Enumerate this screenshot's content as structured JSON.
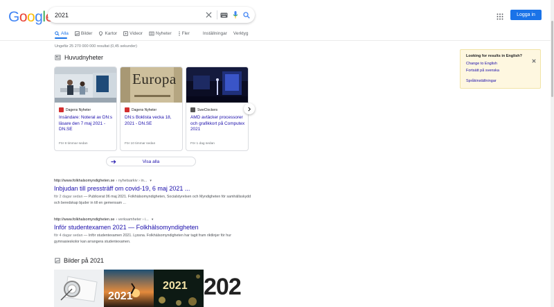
{
  "header": {
    "logo_text": "Google",
    "search_value": "2021",
    "login_label": "Logga in"
  },
  "tabs": [
    {
      "label": "Alla",
      "icon": "search-icon"
    },
    {
      "label": "Bilder",
      "icon": "image-icon"
    },
    {
      "label": "Kartor",
      "icon": "map-pin-icon"
    },
    {
      "label": "Videor",
      "icon": "video-icon"
    },
    {
      "label": "Nyheter",
      "icon": "news-icon"
    },
    {
      "label": "Fler",
      "icon": "more-icon"
    },
    {
      "label": "Inställningar"
    },
    {
      "label": "Verktyg"
    }
  ],
  "stats": "Ungefär 25 270 000 000 resultat (0,45 sekunder)",
  "top_stories": {
    "title": "Huvudnyheter",
    "cards": [
      {
        "source": "Dagens Nyheter",
        "headline": "Insändare: Noteral av DN:s läsare den 7 maj 2021 - DN.SE",
        "time": "För 8 timmar sedan",
        "favicon_color": "#d32f2f"
      },
      {
        "source": "Dagens Nyheter",
        "headline": "DN:s Boklista vecka 18, 2021 - DN.SE",
        "time": "För 10 timmar sedan",
        "favicon_color": "#d32f2f",
        "thumb_text": "Europa"
      },
      {
        "source": "SweClockers",
        "headline": "AMD avtäcker processorer och grafikkort på Computex 2021",
        "time": "För 1 dag sedan",
        "favicon_color": "#555555"
      }
    ],
    "show_all_label": "Visa alla"
  },
  "results": [
    {
      "url": "http://www.folkhalsomyndigheten.se",
      "crumb": "› nyhetsarkiv › in...",
      "title": "Inbjudan till pressträff om covid-19, 6 maj 2021 ...",
      "date": "för 2 dagar sedan",
      "snippet": " — Publicerat 06 maj 2021. Folkhälsomyndigheten, Socialstyrelsen och Myndigheten för samhällsskydd och beredskap bjuder in till en gemensam ..."
    },
    {
      "url": "http://www.folkhalsomyndigheten.se",
      "crumb": "› verksamheter › i...",
      "title": "Inför studentexamen 2021 — Folkhälsomyndigheten",
      "date": "för 4 dagar sedan",
      "snippet": " — Inför studentexamen 2021. Lyssna. Folkhälsomyndigheten har tagit fram riktlinjer för hur gymnasieskolor kan arrangera studentexamen."
    }
  ],
  "images_section": {
    "title": "Bilder på 2021",
    "tiles": [
      {
        "text": ""
      },
      {
        "text": "2021"
      },
      {
        "text": "2021"
      },
      {
        "text": "202"
      }
    ]
  },
  "language_panel": {
    "question": "Looking for results in English?",
    "change": "Change to English",
    "keep": "Fortsätt på svenska",
    "settings": "Språkinställningar"
  },
  "colors": {
    "link": "#1a0dab",
    "accent": "#1a73e8"
  }
}
